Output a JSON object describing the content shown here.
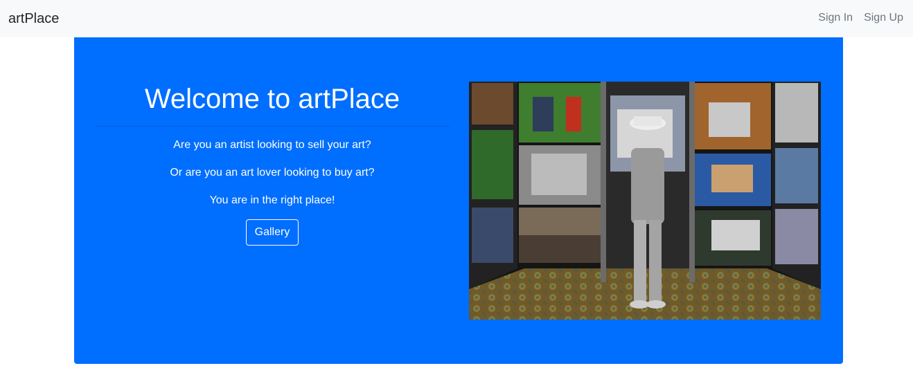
{
  "navbar": {
    "brand": "artPlace",
    "links": [
      {
        "label": "Sign In"
      },
      {
        "label": "Sign Up"
      }
    ]
  },
  "hero": {
    "title": "Welcome to artPlace",
    "lines": [
      "Are you an artist looking to sell your art?",
      "Or are you an art lover looking to buy art?",
      "You are in the right place!"
    ],
    "button_label": "Gallery",
    "background_color": "#006efe"
  }
}
